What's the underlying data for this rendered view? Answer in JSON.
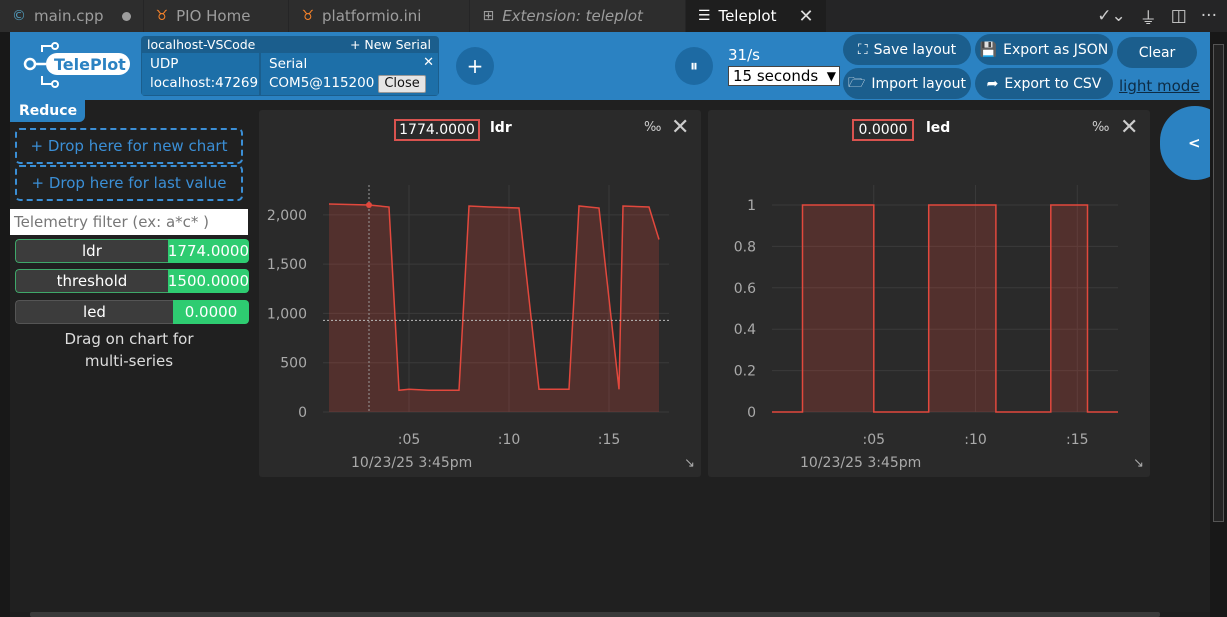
{
  "tabs": [
    {
      "label": "main.cpp",
      "icon": "c-plus-plus-icon",
      "modified": true
    },
    {
      "label": "PIO Home",
      "icon": "platformio-icon"
    },
    {
      "label": "platformio.ini",
      "icon": "platformio-icon"
    },
    {
      "label": "Extension: teleplot",
      "icon": "extensions-icon",
      "italic": true
    },
    {
      "label": "Teleplot",
      "icon": "preview-icon",
      "active": true
    }
  ],
  "header": {
    "logo_text": "TelePlot",
    "connection": {
      "name": "localhost-VSCode",
      "new_serial": "+ New Serial",
      "udp": {
        "type": "UDP",
        "address": "localhost:47269"
      },
      "serial": {
        "type": "Serial",
        "port": "COM5@115200",
        "close_label": "Close"
      }
    },
    "add_label": "+",
    "pause_label": "⏸",
    "rate": "31/s",
    "window": {
      "selected": "15 seconds"
    },
    "buttons": {
      "save_layout": "Save layout",
      "import_layout": "Import layout",
      "export_json": "Export as JSON",
      "export_csv": "Export to CSV",
      "clear": "Clear",
      "light_mode": "light mode"
    }
  },
  "sidebar": {
    "reduce": "Reduce",
    "drop_new_chart": "+ Drop here for new chart",
    "drop_last_value": "+ Drop here for last value",
    "filter_placeholder": "Telemetry filter (ex: a*c* )",
    "telemetry": [
      {
        "name": "ldr",
        "value": "1774.0000"
      },
      {
        "name": "threshold",
        "value": "1500.0000"
      },
      {
        "name": "led",
        "value": "0.0000"
      }
    ],
    "hint_line1": "Drag on chart for",
    "hint_line2": "multi-series"
  },
  "side_toggle": "<",
  "charts": [
    {
      "value": "1774.0000",
      "series": "ldr",
      "pct_icon": "‰",
      "date": "10/23/25 3:45pm",
      "color": "#e2483d"
    },
    {
      "value": "0.0000",
      "series": "led",
      "pct_icon": "‰",
      "date": "10/23/25 3:45pm",
      "color": "#e2483d"
    }
  ],
  "chart_data": [
    {
      "type": "area",
      "series": [
        {
          "name": "ldr",
          "x": [
            1.0,
            3.0,
            4.0,
            4.5,
            5.0,
            6.0,
            7.5,
            8.0,
            9.0,
            10.5,
            11.5,
            13.0,
            13.5,
            14.5,
            15.5,
            15.7,
            17.0,
            17.5
          ],
          "y": [
            2110,
            2100,
            2080,
            220,
            230,
            220,
            220,
            2090,
            2080,
            2070,
            230,
            230,
            2090,
            2070,
            230,
            2090,
            2080,
            1750
          ]
        }
      ],
      "x_ticks": [
        ":05",
        ":10",
        ":15"
      ],
      "x_tick_values": [
        5,
        10,
        15
      ],
      "y_ticks": [
        "0",
        "500",
        "1,000",
        "1,500",
        "2,000"
      ],
      "y_tick_values": [
        0,
        500,
        1000,
        1500,
        2000
      ],
      "xlim": [
        0.7,
        18.0
      ],
      "ylim": [
        0,
        2100
      ],
      "cursor": {
        "x": 3.0,
        "y": 2100
      },
      "threshold": 930
    },
    {
      "type": "area",
      "series": [
        {
          "name": "led",
          "x": [
            0.0,
            1.5,
            1.5,
            5.0,
            5.0,
            7.7,
            7.7,
            11.0,
            11.0,
            13.7,
            13.7,
            15.5,
            15.5,
            17.0
          ],
          "y": [
            0,
            0,
            1,
            1,
            0,
            0,
            1,
            1,
            0,
            0,
            1,
            1,
            0,
            0
          ]
        }
      ],
      "x_ticks": [
        ":05",
        ":10",
        ":15"
      ],
      "x_tick_values": [
        5,
        10,
        15
      ],
      "y_ticks": [
        "0",
        "0.2",
        "0.4",
        "0.6",
        "0.8",
        "1"
      ],
      "y_tick_values": [
        0,
        0.2,
        0.4,
        0.6,
        0.8,
        1
      ],
      "xlim": [
        0.0,
        17.0
      ],
      "ylim": [
        0,
        1
      ]
    }
  ]
}
